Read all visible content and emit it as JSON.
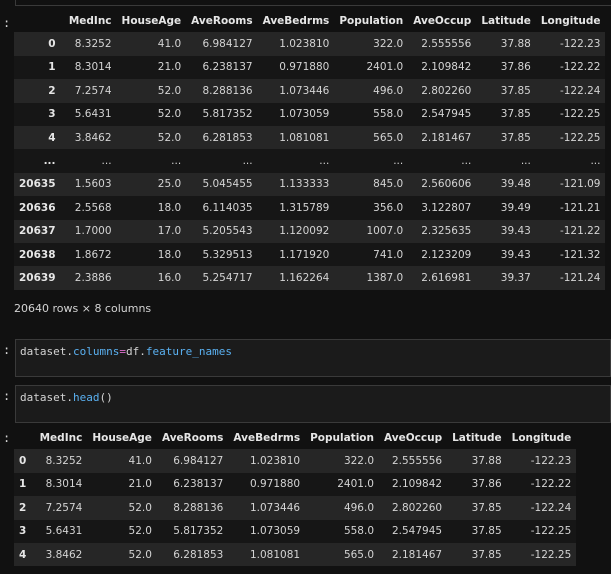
{
  "prompt_marker": ":",
  "df_full": {
    "columns": [
      "",
      "MedInc",
      "HouseAge",
      "AveRooms",
      "AveBedrms",
      "Population",
      "AveOccup",
      "Latitude",
      "Longitude"
    ],
    "rows": [
      [
        "0",
        "8.3252",
        "41.0",
        "6.984127",
        "1.023810",
        "322.0",
        "2.555556",
        "37.88",
        "-122.23"
      ],
      [
        "1",
        "8.3014",
        "21.0",
        "6.238137",
        "0.971880",
        "2401.0",
        "2.109842",
        "37.86",
        "-122.22"
      ],
      [
        "2",
        "7.2574",
        "52.0",
        "8.288136",
        "1.073446",
        "496.0",
        "2.802260",
        "37.85",
        "-122.24"
      ],
      [
        "3",
        "5.6431",
        "52.0",
        "5.817352",
        "1.073059",
        "558.0",
        "2.547945",
        "37.85",
        "-122.25"
      ],
      [
        "4",
        "3.8462",
        "52.0",
        "6.281853",
        "1.081081",
        "565.0",
        "2.181467",
        "37.85",
        "-122.25"
      ],
      [
        "...",
        "...",
        "...",
        "...",
        "...",
        "...",
        "...",
        "...",
        "..."
      ],
      [
        "20635",
        "1.5603",
        "25.0",
        "5.045455",
        "1.133333",
        "845.0",
        "2.560606",
        "39.48",
        "-121.09"
      ],
      [
        "20636",
        "2.5568",
        "18.0",
        "6.114035",
        "1.315789",
        "356.0",
        "3.122807",
        "39.49",
        "-121.21"
      ],
      [
        "20637",
        "1.7000",
        "17.0",
        "5.205543",
        "1.120092",
        "1007.0",
        "2.325635",
        "39.43",
        "-121.22"
      ],
      [
        "20638",
        "1.8672",
        "18.0",
        "5.329513",
        "1.171920",
        "741.0",
        "2.123209",
        "39.43",
        "-121.32"
      ],
      [
        "20639",
        "2.3886",
        "16.0",
        "5.254717",
        "1.162264",
        "1387.0",
        "2.616981",
        "39.37",
        "-121.24"
      ]
    ]
  },
  "shape_text": "20640 rows × 8 columns",
  "cell_columns": {
    "obj": "dataset",
    "dot1": ".",
    "attr": "columns",
    "op": "=",
    "obj2": "df",
    "dot2": ".",
    "attr2": "feature_names"
  },
  "cell_head": {
    "obj": "dataset",
    "dot": ".",
    "fn": "head",
    "args": "()"
  },
  "df_head": {
    "columns": [
      "",
      "MedInc",
      "HouseAge",
      "AveRooms",
      "AveBedrms",
      "Population",
      "AveOccup",
      "Latitude",
      "Longitude"
    ],
    "rows": [
      [
        "0",
        "8.3252",
        "41.0",
        "6.984127",
        "1.023810",
        "322.0",
        "2.555556",
        "37.88",
        "-122.23"
      ],
      [
        "1",
        "8.3014",
        "21.0",
        "6.238137",
        "0.971880",
        "2401.0",
        "2.109842",
        "37.86",
        "-122.22"
      ],
      [
        "2",
        "7.2574",
        "52.0",
        "8.288136",
        "1.073446",
        "496.0",
        "2.802260",
        "37.85",
        "-122.24"
      ],
      [
        "3",
        "5.6431",
        "52.0",
        "5.817352",
        "1.073059",
        "558.0",
        "2.547945",
        "37.85",
        "-122.25"
      ],
      [
        "4",
        "3.8462",
        "52.0",
        "6.281853",
        "1.081081",
        "565.0",
        "2.181467",
        "37.85",
        "-122.25"
      ]
    ]
  }
}
